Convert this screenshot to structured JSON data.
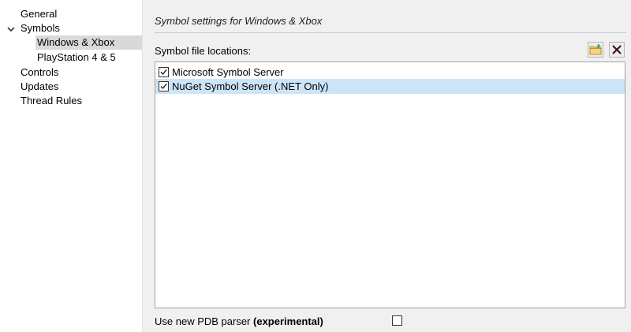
{
  "nav": {
    "items": [
      {
        "label": "General"
      },
      {
        "label": "Symbols"
      },
      {
        "label": "Windows & Xbox"
      },
      {
        "label": "PlayStation 4 & 5"
      },
      {
        "label": "Controls"
      },
      {
        "label": "Updates"
      },
      {
        "label": "Thread Rules"
      }
    ],
    "expanded_icon": "chevron-down-icon",
    "selected_item": "Windows & Xbox"
  },
  "panel": {
    "title": "Symbol settings for Windows & Xbox",
    "locations_label": "Symbol file locations:",
    "add_button_icon": "folder-add-icon",
    "remove_button_icon": "close-icon",
    "locations": [
      {
        "label": "Microsoft Symbol Server",
        "checked": true,
        "selected": false
      },
      {
        "label": "NuGet Symbol Server (.NET Only)",
        "checked": true,
        "selected": true
      }
    ],
    "pdb_parser": {
      "label": "Use new PDB parser",
      "label_bold": "(experimental)",
      "checked": false
    }
  },
  "colors": {
    "selected_nav_bg": "#d9d9d9",
    "selected_row_bg": "#cce4f7",
    "panel_bg": "#f0f0f0"
  }
}
